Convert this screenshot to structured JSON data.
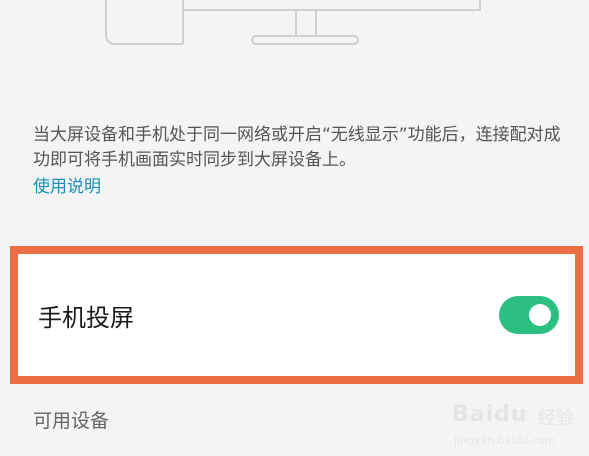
{
  "description": "当大屏设备和手机处于同一网络或开启“无线显示”功能后，连接配对成功即可将手机画面实时同步到大屏设备上。",
  "help_link": "使用说明",
  "setting": {
    "label": "手机投屏",
    "toggle_on": true,
    "accent_color": "#2bbf81"
  },
  "section_title": "可用设备",
  "highlight_color": "#ee6d42",
  "watermark": {
    "brand": "Baidu",
    "tag": "经验",
    "url": "jingyan.baidu.com"
  }
}
